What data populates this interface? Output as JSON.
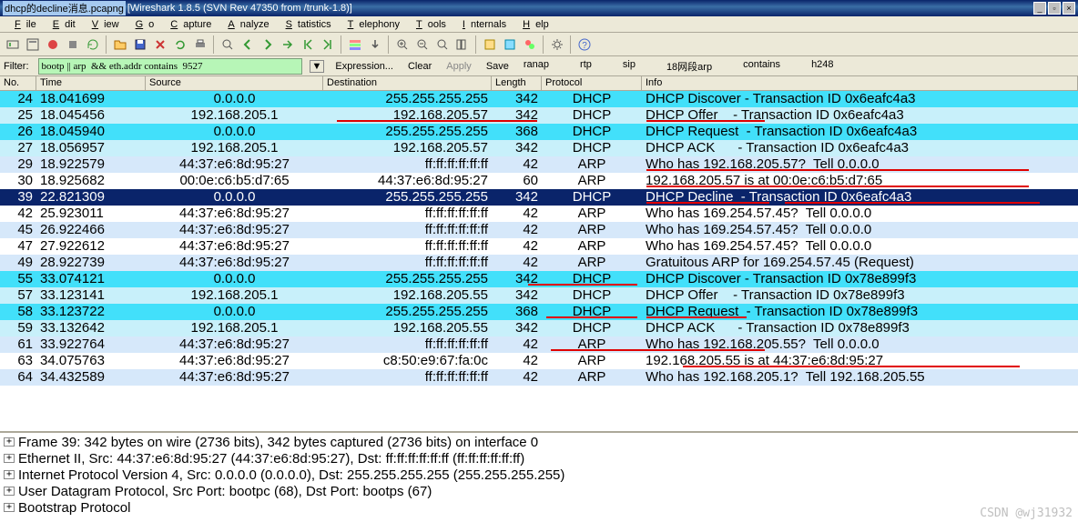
{
  "title": {
    "doc": "dhcp的decline消息.pcapng",
    "app": "[Wireshark 1.8.5  (SVN Rev 47350 from /trunk-1.8)]"
  },
  "menu": [
    "File",
    "Edit",
    "View",
    "Go",
    "Capture",
    "Analyze",
    "Statistics",
    "Telephony",
    "Tools",
    "Internals",
    "Help"
  ],
  "filter": {
    "label": "Filter:",
    "value": "bootp || arp  && eth.addr contains  9527",
    "expression": "Expression...",
    "clear": "Clear",
    "apply": "Apply",
    "save": "Save",
    "extra": [
      "ranap",
      "rtp",
      "sip",
      "18网段arp",
      "contains",
      "h248"
    ]
  },
  "columns": [
    "No.",
    "Time",
    "Source",
    "Destination",
    "Length",
    "Protocol",
    "Info"
  ],
  "packets": [
    {
      "no": "24",
      "time": "18.041699",
      "src": "0.0.0.0",
      "dst": "255.255.255.255",
      "len": "342",
      "proto": "DHCP",
      "info": "DHCP Discover - Transaction ID 0x6eafc4a3",
      "css": "dhcp-disc"
    },
    {
      "no": "25",
      "time": "18.045456",
      "src": "192.168.205.1",
      "dst": "192.168.205.57",
      "len": "342",
      "proto": "DHCP",
      "info": "DHCP Offer    - Transaction ID 0x6eafc4a3",
      "css": "dhcp-offer"
    },
    {
      "no": "26",
      "time": "18.045940",
      "src": "0.0.0.0",
      "dst": "255.255.255.255",
      "len": "368",
      "proto": "DHCP",
      "info": "DHCP Request  - Transaction ID 0x6eafc4a3",
      "css": "dhcp-req"
    },
    {
      "no": "27",
      "time": "18.056957",
      "src": "192.168.205.1",
      "dst": "192.168.205.57",
      "len": "342",
      "proto": "DHCP",
      "info": "DHCP ACK      - Transaction ID 0x6eafc4a3",
      "css": "dhcp-ack"
    },
    {
      "no": "29",
      "time": "18.922579",
      "src": "44:37:e6:8d:95:27",
      "dst": "ff:ff:ff:ff:ff:ff",
      "len": "42",
      "proto": "ARP",
      "info": "Who has 192.168.205.57?  Tell 0.0.0.0",
      "css": "arp1"
    },
    {
      "no": "30",
      "time": "18.925682",
      "src": "00:0e:c6:b5:d7:65",
      "dst": "44:37:e6:8d:95:27",
      "len": "60",
      "proto": "ARP",
      "info": "192.168.205.57 is at 00:0e:c6:b5:d7:65",
      "css": "arp2"
    },
    {
      "no": "39",
      "time": "22.821309",
      "src": "0.0.0.0",
      "dst": "255.255.255.255",
      "len": "342",
      "proto": "DHCP",
      "info": "DHCP Decline  - Transaction ID 0x6eafc4a3",
      "css": "selected"
    },
    {
      "no": "42",
      "time": "25.923011",
      "src": "44:37:e6:8d:95:27",
      "dst": "ff:ff:ff:ff:ff:ff",
      "len": "42",
      "proto": "ARP",
      "info": "Who has 169.254.57.45?  Tell 0.0.0.0",
      "css": "arp2"
    },
    {
      "no": "45",
      "time": "26.922466",
      "src": "44:37:e6:8d:95:27",
      "dst": "ff:ff:ff:ff:ff:ff",
      "len": "42",
      "proto": "ARP",
      "info": "Who has 169.254.57.45?  Tell 0.0.0.0",
      "css": "arp1"
    },
    {
      "no": "47",
      "time": "27.922612",
      "src": "44:37:e6:8d:95:27",
      "dst": "ff:ff:ff:ff:ff:ff",
      "len": "42",
      "proto": "ARP",
      "info": "Who has 169.254.57.45?  Tell 0.0.0.0",
      "css": "arp2"
    },
    {
      "no": "49",
      "time": "28.922739",
      "src": "44:37:e6:8d:95:27",
      "dst": "ff:ff:ff:ff:ff:ff",
      "len": "42",
      "proto": "ARP",
      "info": "Gratuitous ARP for 169.254.57.45 (Request)",
      "css": "arp1"
    },
    {
      "no": "55",
      "time": "33.074121",
      "src": "0.0.0.0",
      "dst": "255.255.255.255",
      "len": "342",
      "proto": "DHCP",
      "info": "DHCP Discover - Transaction ID 0x78e899f3",
      "css": "dhcp-disc"
    },
    {
      "no": "57",
      "time": "33.123141",
      "src": "192.168.205.1",
      "dst": "192.168.205.55",
      "len": "342",
      "proto": "DHCP",
      "info": "DHCP Offer    - Transaction ID 0x78e899f3",
      "css": "dhcp-offer"
    },
    {
      "no": "58",
      "time": "33.123722",
      "src": "0.0.0.0",
      "dst": "255.255.255.255",
      "len": "368",
      "proto": "DHCP",
      "info": "DHCP Request  - Transaction ID 0x78e899f3",
      "css": "dhcp-req"
    },
    {
      "no": "59",
      "time": "33.132642",
      "src": "192.168.205.1",
      "dst": "192.168.205.55",
      "len": "342",
      "proto": "DHCP",
      "info": "DHCP ACK      - Transaction ID 0x78e899f3",
      "css": "dhcp-ack"
    },
    {
      "no": "61",
      "time": "33.922764",
      "src": "44:37:e6:8d:95:27",
      "dst": "ff:ff:ff:ff:ff:ff",
      "len": "42",
      "proto": "ARP",
      "info": "Who has 192.168.205.55?  Tell 0.0.0.0",
      "css": "arp1"
    },
    {
      "no": "63",
      "time": "34.075763",
      "src": "44:37:e6:8d:95:27",
      "dst": "c8:50:e9:67:fa:0c",
      "len": "42",
      "proto": "ARP",
      "info": "192.168.205.55 is at 44:37:e6:8d:95:27",
      "css": "arp2"
    },
    {
      "no": "64",
      "time": "34.432589",
      "src": "44:37:e6:8d:95:27",
      "dst": "ff:ff:ff:ff:ff:ff",
      "len": "42",
      "proto": "ARP",
      "info": "Who has 192.168.205.1?  Tell 192.168.205.55",
      "css": "arp1"
    }
  ],
  "details": [
    "Frame 39: 342 bytes on wire (2736 bits), 342 bytes captured (2736 bits) on interface 0",
    "Ethernet II, Src: 44:37:e6:8d:95:27 (44:37:e6:8d:95:27), Dst: ff:ff:ff:ff:ff:ff (ff:ff:ff:ff:ff:ff)",
    "Internet Protocol Version 4, Src: 0.0.0.0 (0.0.0.0), Dst: 255.255.255.255 (255.255.255.255)",
    "User Datagram Protocol, Src Port: bootpc (68), Dst Port: bootps (67)",
    "Bootstrap Protocol"
  ],
  "watermark": "CSDN @wj31932"
}
